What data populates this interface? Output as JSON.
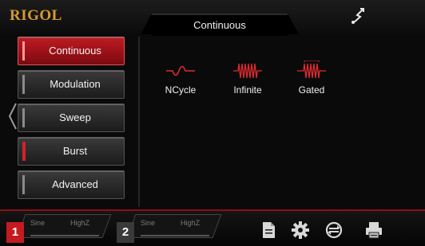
{
  "header": {
    "brand": "RIGOL",
    "title": "Continuous",
    "status_icon": "usb-icon"
  },
  "sidebar": {
    "items": [
      {
        "label": "Continuous",
        "active": true
      },
      {
        "label": "Modulation",
        "active": false
      },
      {
        "label": "Sweep",
        "active": false
      },
      {
        "label": "Burst",
        "active": false
      },
      {
        "label": "Advanced",
        "active": false
      }
    ]
  },
  "modes": [
    {
      "label": "NCycle",
      "icon": "ncycle-icon"
    },
    {
      "label": "Infinite",
      "icon": "infinite-burst-icon"
    },
    {
      "label": "Gated",
      "icon": "gated-burst-icon"
    }
  ],
  "channels": [
    {
      "number": "1",
      "waveform": "Sine",
      "impedance": "HighZ",
      "active": true
    },
    {
      "number": "2",
      "waveform": "Sine",
      "impedance": "HighZ",
      "active": false
    }
  ],
  "toolbar": {
    "icons": [
      "file-icon",
      "settings-gear-icon",
      "sync-icon",
      "printer-icon"
    ]
  },
  "colors": {
    "brand": "#d89a2e",
    "accent_red": "#c41a20",
    "mode_icon": "#e02a30"
  }
}
